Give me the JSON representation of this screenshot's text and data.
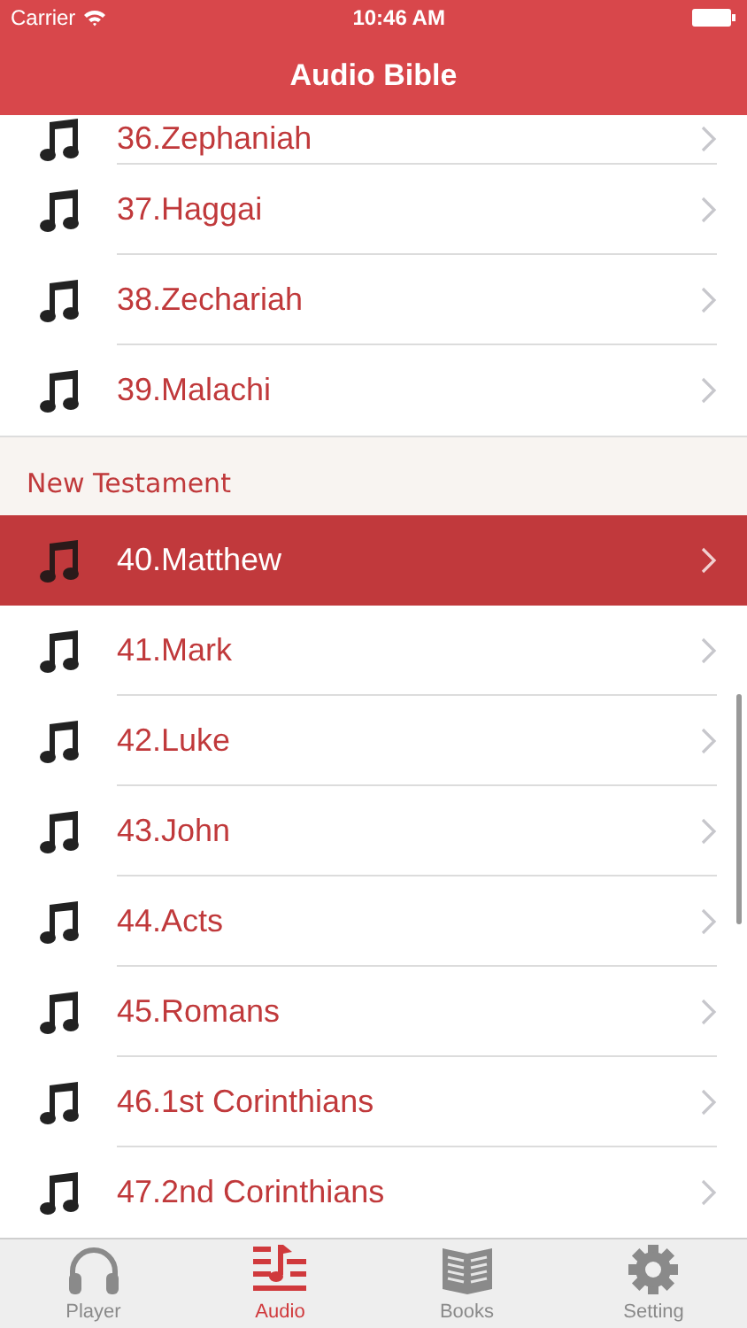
{
  "status_bar": {
    "carrier": "Carrier",
    "time": "10:46 AM"
  },
  "nav": {
    "title": "Audio Bible"
  },
  "sections": [
    {
      "rows": [
        {
          "label": "36.Zephaniah",
          "selected": false
        },
        {
          "label": "37.Haggai",
          "selected": false
        },
        {
          "label": "38.Zechariah",
          "selected": false
        },
        {
          "label": "39.Malachi",
          "selected": false
        }
      ]
    },
    {
      "header": "New Testament",
      "rows": [
        {
          "label": "40.Matthew",
          "selected": true
        },
        {
          "label": "41.Mark",
          "selected": false
        },
        {
          "label": "42.Luke",
          "selected": false
        },
        {
          "label": "43.John",
          "selected": false
        },
        {
          "label": "44.Acts",
          "selected": false
        },
        {
          "label": "45.Romans",
          "selected": false
        },
        {
          "label": "46.1st Corinthians",
          "selected": false
        },
        {
          "label": "47.2nd Corinthians",
          "selected": false
        }
      ]
    }
  ],
  "tabs": [
    {
      "label": "Player",
      "kind": "headphones",
      "selected": false
    },
    {
      "label": "Audio",
      "kind": "audio",
      "selected": true
    },
    {
      "label": "Books",
      "kind": "book",
      "selected": false
    },
    {
      "label": "Setting",
      "kind": "gear",
      "selected": false
    }
  ]
}
